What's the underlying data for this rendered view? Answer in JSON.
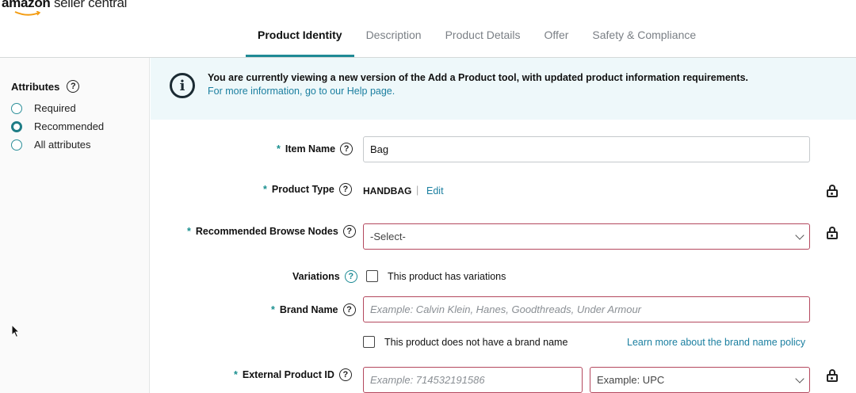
{
  "header": {
    "logo_brand": "amazon",
    "logo_product": "seller central"
  },
  "tabs": [
    {
      "label": "Product Identity",
      "active": true
    },
    {
      "label": "Description",
      "active": false
    },
    {
      "label": "Product Details",
      "active": false
    },
    {
      "label": "Offer",
      "active": false
    },
    {
      "label": "Safety & Compliance",
      "active": false
    }
  ],
  "sidebar": {
    "title": "Attributes",
    "help_glyph": "?",
    "options": [
      {
        "label": "Required",
        "selected": false
      },
      {
        "label": "Recommended",
        "selected": true
      },
      {
        "label": "All attributes",
        "selected": false
      }
    ]
  },
  "banner": {
    "icon": "info-icon",
    "glyph": "i",
    "message": "You are currently viewing a new version of the Add a Product tool, with updated product information requirements.",
    "link": "For more information, go to our Help page."
  },
  "form": {
    "required_mark": "*",
    "help_glyph": "?",
    "item_name": {
      "label": "Item Name",
      "value": "Bag"
    },
    "product_type": {
      "label": "Product Type",
      "value": "HANDBAG",
      "separator": "|",
      "edit": "Edit"
    },
    "browse_nodes": {
      "label": "Recommended Browse Nodes",
      "value": "-Select-"
    },
    "variations": {
      "label": "Variations",
      "checkbox_label": "This product has variations"
    },
    "brand_name": {
      "label": "Brand Name",
      "placeholder": "Example: Calvin Klein, Hanes, Goodthreads, Under Armour",
      "no_brand_label": "This product does not have a brand name",
      "policy_link": "Learn more about the brand name policy"
    },
    "external_id": {
      "label": "External Product ID",
      "placeholder": "Example: 714532191586",
      "type_placeholder": "Example: UPC"
    }
  },
  "colors": {
    "accent": "#1f8a95",
    "link": "#1b7fa0",
    "error_border": "#b4485e",
    "banner_bg": "#eef8fa"
  }
}
